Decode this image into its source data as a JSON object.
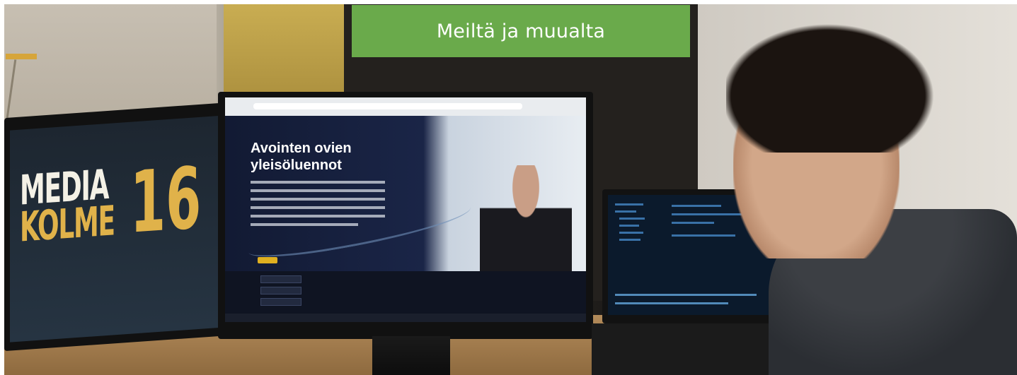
{
  "banner": {
    "title": "Meiltä ja muualta",
    "background_color": "#6aaa4b",
    "text_color": "#ffffff"
  },
  "photo": {
    "left_monitor": {
      "line1": "MEDIA",
      "line2": "KOLME",
      "number": "16"
    },
    "center_monitor": {
      "hero_title_line1": "Avointen ovien",
      "hero_title_line2": "yleisöluennot"
    }
  }
}
